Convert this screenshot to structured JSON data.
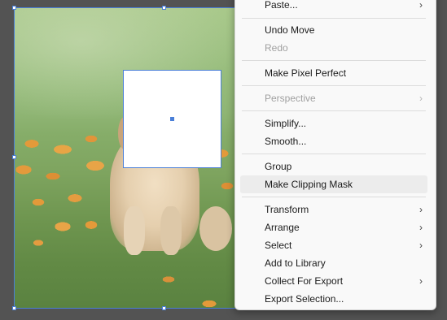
{
  "canvas": {
    "photo_subject": "puppy-in-flower-field",
    "selection_color": "#4a7fd8"
  },
  "context_menu": {
    "items": [
      {
        "label": "Paste...",
        "has_submenu": true,
        "disabled": false
      },
      {
        "label": "Undo Move",
        "has_submenu": false,
        "disabled": false
      },
      {
        "label": "Redo",
        "has_submenu": false,
        "disabled": true
      },
      {
        "label": "Make Pixel Perfect",
        "has_submenu": false,
        "disabled": false
      },
      {
        "label": "Perspective",
        "has_submenu": true,
        "disabled": true
      },
      {
        "label": "Simplify...",
        "has_submenu": false,
        "disabled": false
      },
      {
        "label": "Smooth...",
        "has_submenu": false,
        "disabled": false
      },
      {
        "label": "Group",
        "has_submenu": false,
        "disabled": false
      },
      {
        "label": "Make Clipping Mask",
        "has_submenu": false,
        "disabled": false,
        "highlighted": true
      },
      {
        "label": "Transform",
        "has_submenu": true,
        "disabled": false
      },
      {
        "label": "Arrange",
        "has_submenu": true,
        "disabled": false
      },
      {
        "label": "Select",
        "has_submenu": true,
        "disabled": false
      },
      {
        "label": "Add to Library",
        "has_submenu": false,
        "disabled": false
      },
      {
        "label": "Collect For Export",
        "has_submenu": true,
        "disabled": false
      },
      {
        "label": "Export Selection...",
        "has_submenu": false,
        "disabled": false
      }
    ],
    "submenu_icon": "chevron-right-icon",
    "submenu_glyph": "›"
  }
}
